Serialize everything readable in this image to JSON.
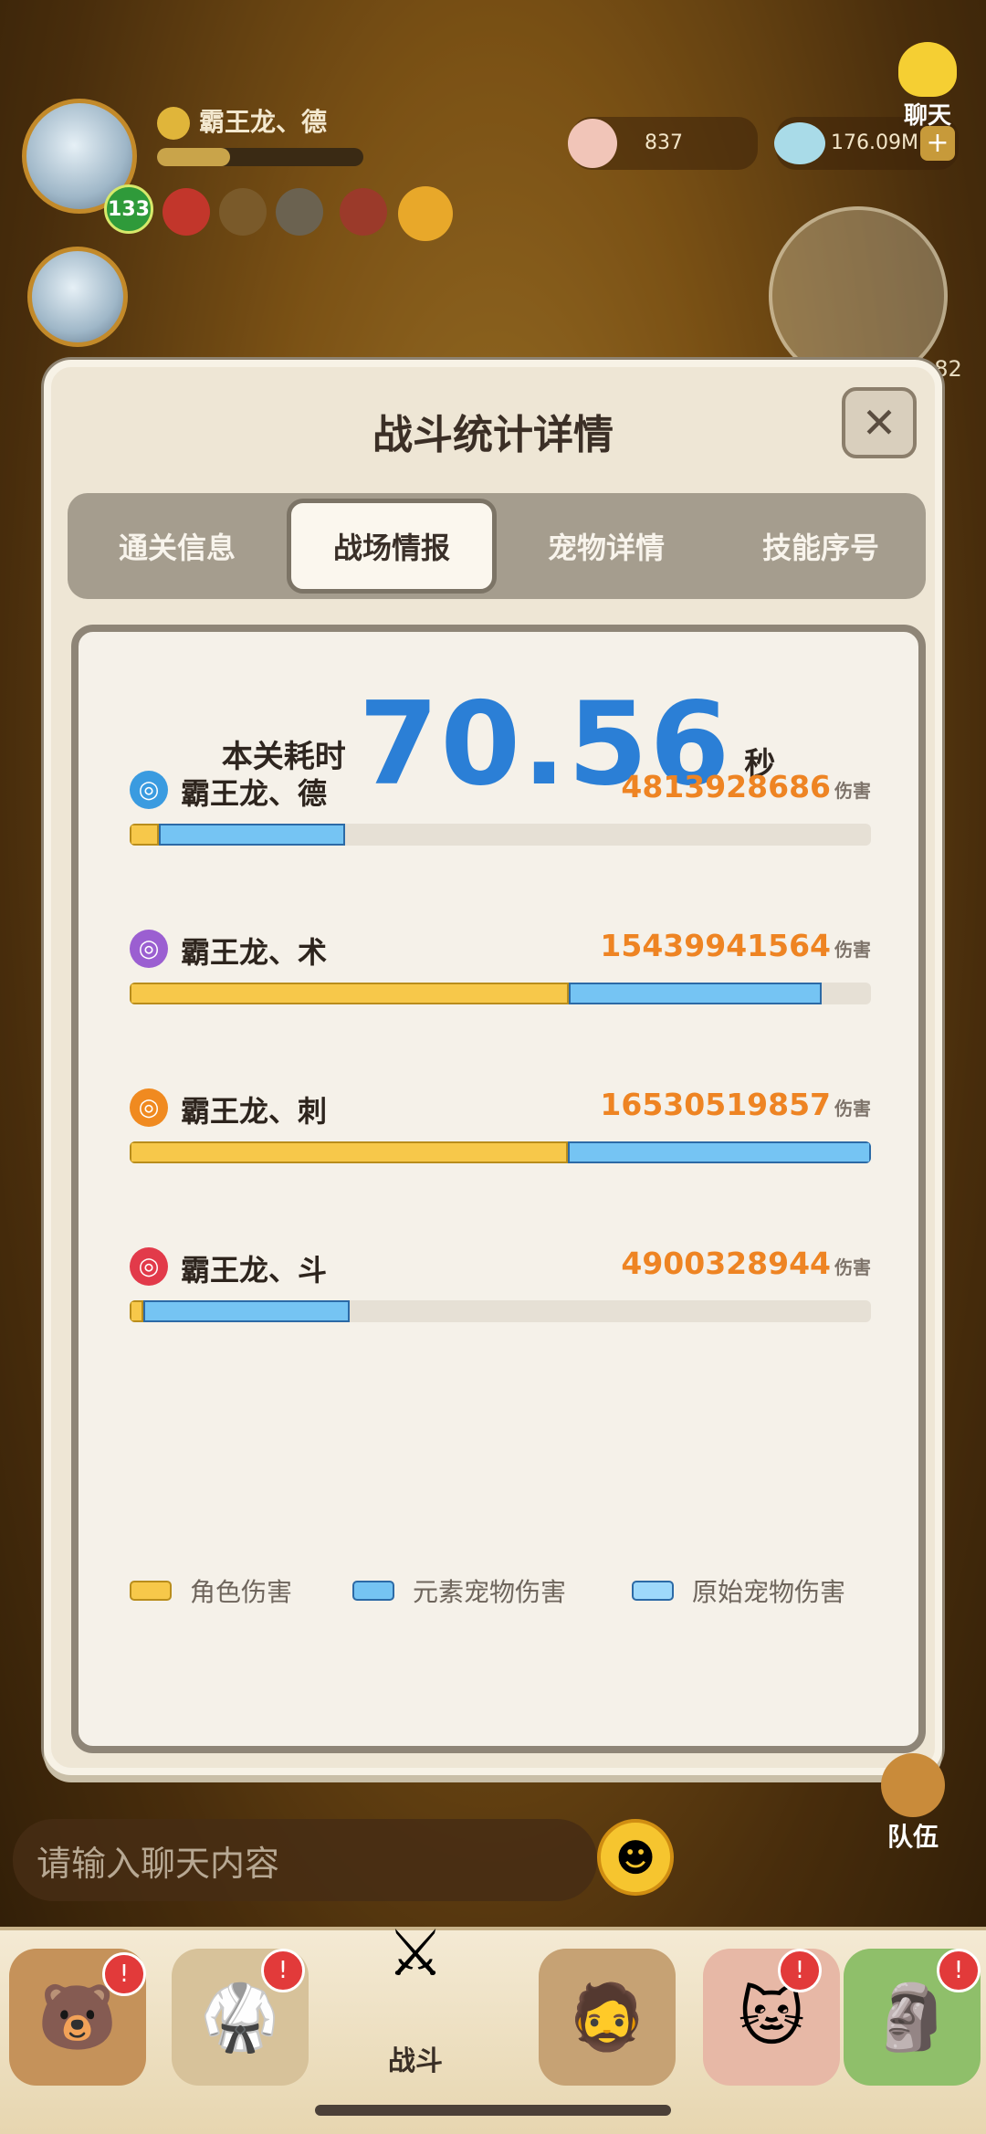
{
  "hud": {
    "player_name": "霸王龙、德",
    "level": "133",
    "shells": "837",
    "gems": "176.09M",
    "side_count": "182",
    "chat_label": "聊天"
  },
  "dialog": {
    "title": "战斗统计详情",
    "close_glyph": "✕",
    "tabs": [
      "通关信息",
      "战场情报",
      "宠物详情",
      "技能序号"
    ],
    "active_tab": 1,
    "time_label": "本关耗时",
    "time_value": "70.56",
    "time_unit": "秒",
    "damage_unit": "伤害"
  },
  "chart_data": {
    "type": "bar",
    "orientation": "horizontal",
    "stacked": true,
    "categories": [
      "霸王龙、德",
      "霸王龙、术",
      "霸王龙、刺",
      "霸王龙、斗"
    ],
    "totals": [
      "4813928686",
      "15439941564",
      "16530519857",
      "4900328944"
    ],
    "series": [
      {
        "name": "角色伤害",
        "color": "#f7c84a",
        "values": [
          650000000,
          9800000000,
          9770000000,
          300000000
        ]
      },
      {
        "name": "元素宠物伤害",
        "color": "#75c4f3",
        "values": [
          4163928686,
          5639941564,
          6760519857,
          4600328944
        ]
      },
      {
        "name": "原始宠物伤害",
        "color": "#9ed9fb",
        "values": [
          0,
          0,
          0,
          0
        ]
      }
    ],
    "xlim": [
      0,
      16530519857
    ],
    "icon_colors": [
      "#3a9be0",
      "#9b5fd1",
      "#f08a20",
      "#e23a4a"
    ],
    "icons": [
      "element-icon",
      "arcane-icon",
      "assassin-icon",
      "fighter-icon"
    ]
  },
  "chat": {
    "placeholder": "请输入聊天内容"
  },
  "nav": {
    "team_label": "队伍",
    "battle_label": "战斗"
  }
}
